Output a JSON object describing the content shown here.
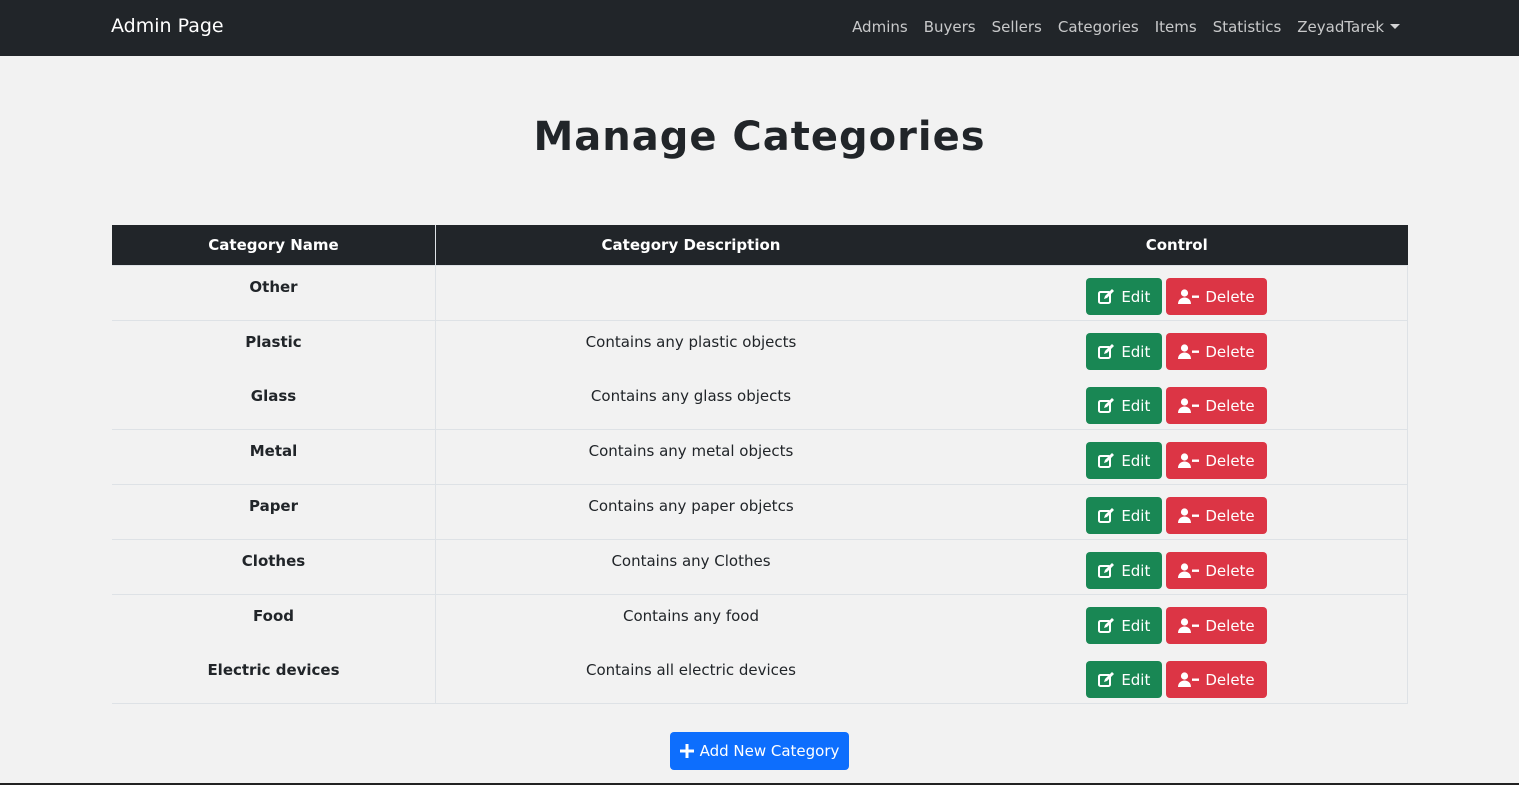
{
  "navbar": {
    "brand": "Admin Page",
    "links": [
      "Admins",
      "Buyers",
      "Sellers",
      "Categories",
      "Items",
      "Statistics"
    ],
    "user": "ZeyadTarek"
  },
  "page": {
    "title": "Manage Categories"
  },
  "table": {
    "headers": [
      "Category Name",
      "Category Description",
      "Control"
    ],
    "rows": [
      {
        "name": "Other",
        "description": ""
      },
      {
        "name": "Plastic",
        "description": "Contains any plastic objects"
      },
      {
        "name": "Glass",
        "description": "Contains any glass objects"
      },
      {
        "name": "Metal",
        "description": "Contains any metal objects"
      },
      {
        "name": "Paper",
        "description": "Contains any paper objetcs"
      },
      {
        "name": "Clothes",
        "description": "Contains any Clothes"
      },
      {
        "name": "Food",
        "description": "Contains any food"
      },
      {
        "name": "Electric devices",
        "description": "Contains all electric devices"
      }
    ],
    "edit_label": "Edit",
    "delete_label": "Delete"
  },
  "add_button": {
    "label": "Add New Category"
  },
  "icons": {
    "edit": "edit-icon",
    "delete": "user-minus-icon",
    "add": "plus-icon",
    "dropdown": "caret-down-icon"
  },
  "colors": {
    "navbar": "#212529",
    "edit": "#198754",
    "delete": "#dc3545",
    "add": "#0d6efd",
    "background": "#f2f2f2"
  }
}
